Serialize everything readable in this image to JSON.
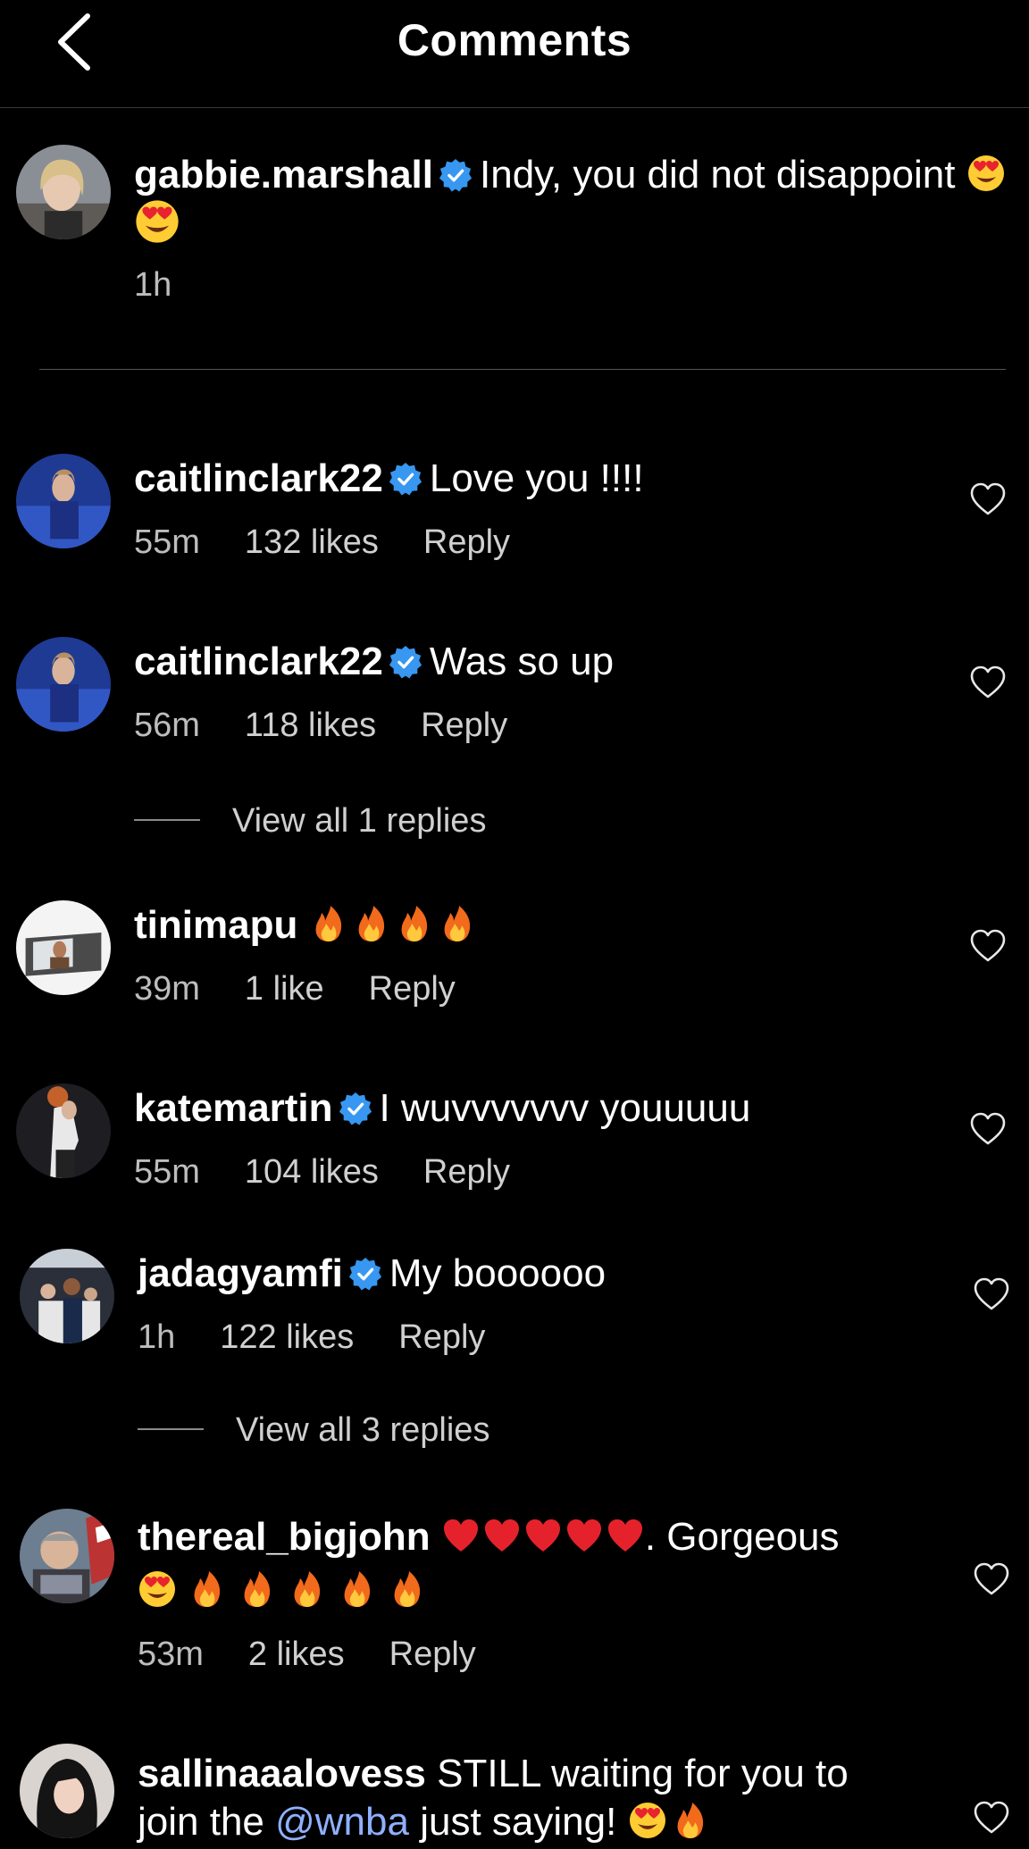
{
  "header": {
    "title": "Comments"
  },
  "caption": {
    "username": "gabbie.marshall",
    "text": "Indy, you did not disappoint",
    "time": "1h"
  },
  "comments": [
    {
      "username": "caitlinclark22",
      "verified": true,
      "text": "Love you !!!!",
      "time": "55m",
      "likes": "132 likes",
      "reply": "Reply"
    },
    {
      "username": "caitlinclark22",
      "verified": true,
      "text": "Was so up",
      "time": "56m",
      "likes": "118 likes",
      "reply": "Reply",
      "view_replies": "View all 1 replies"
    },
    {
      "username": "tinimapu",
      "verified": false,
      "text": "",
      "time": "39m",
      "likes": "1 like",
      "reply": "Reply"
    },
    {
      "username": "katemartin",
      "verified": true,
      "text": "I wuvvvvvvv youuuuu",
      "time": "55m",
      "likes": "104 likes",
      "reply": "Reply"
    },
    {
      "username": "jadagyamfi",
      "verified": true,
      "text": "My boooooo",
      "time": "1h",
      "likes": "122 likes",
      "reply": "Reply",
      "view_replies": "View all 3 replies"
    },
    {
      "username": "thereal_bigjohn",
      "verified": false,
      "text": ". Gorgeous",
      "time": "53m",
      "likes": "2 likes",
      "reply": "Reply"
    },
    {
      "username": "sallinaaalovess",
      "verified": false,
      "text": "STILL waiting for you to",
      "text2_start": "join the ",
      "mention": "@wnba",
      "text2_end": " just saying!"
    }
  ],
  "icons": {
    "back": "chevron-left-icon",
    "verified": "verified-badge-icon",
    "heart": "heart-outline-icon",
    "fire": "fire-emoji",
    "heart_eyes": "heart-eyes-emoji",
    "red_heart": "red-heart-emoji"
  },
  "colors": {
    "background": "#000000",
    "verified": "#3897f0",
    "mention": "#8fb0ff"
  }
}
